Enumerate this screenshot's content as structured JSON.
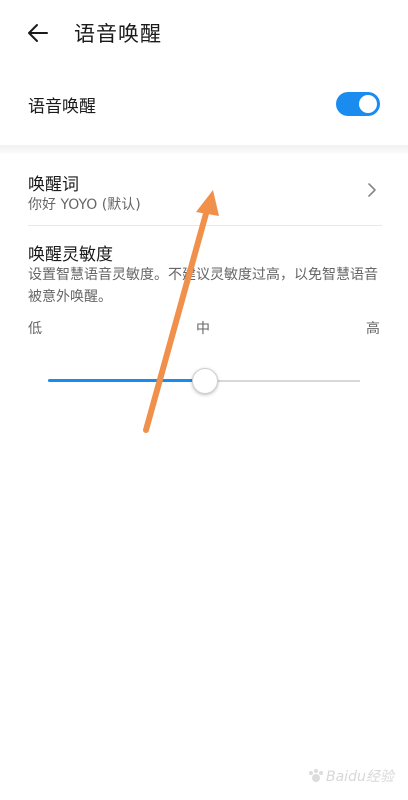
{
  "header": {
    "title": "语音唤醒",
    "back_icon": "arrow-left-icon"
  },
  "voice_wake": {
    "label": "语音唤醒",
    "enabled": true,
    "switch_color": "#1a8cf0"
  },
  "wake_word": {
    "title": "唤醒词",
    "value": "你好 YOYO (默认)",
    "chevron_icon": "chevron-right-icon"
  },
  "sensitivity": {
    "title": "唤醒灵敏度",
    "description": "设置智慧语音灵敏度。不建议灵敏度过高，以免智慧语音被意外唤醒。",
    "low_label": "低",
    "mid_label": "中",
    "high_label": "高",
    "level_fraction": 0.5,
    "accent_color": "#1a8cf0"
  },
  "annotation": {
    "arrow_color": "#f0904a"
  },
  "watermark": {
    "text": "Baidu经验"
  }
}
